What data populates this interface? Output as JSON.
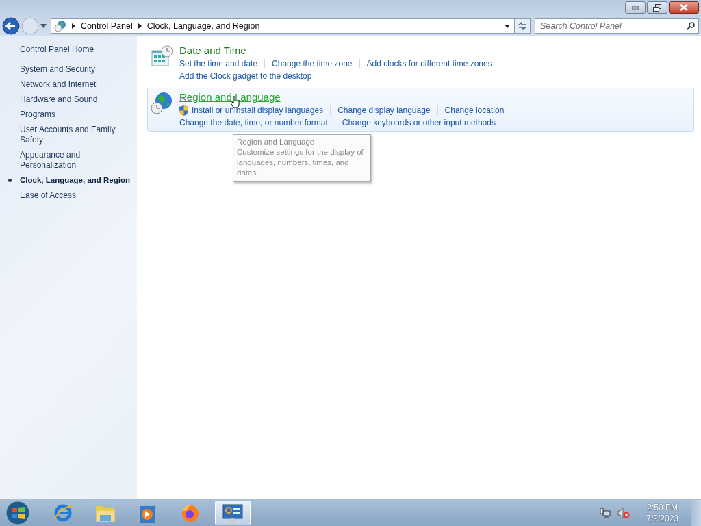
{
  "window": {
    "controls": [
      {
        "kind": "minimize"
      },
      {
        "kind": "restore"
      },
      {
        "kind": "close"
      }
    ]
  },
  "address": {
    "crumbs": [
      "Control Panel",
      "Clock, Language, and Region"
    ]
  },
  "search": {
    "placeholder": "Search Control Panel"
  },
  "sidebar": {
    "home": "Control Panel Home",
    "items": [
      {
        "label": "System and Security",
        "selected": false
      },
      {
        "label": "Network and Internet",
        "selected": false
      },
      {
        "label": "Hardware and Sound",
        "selected": false
      },
      {
        "label": "Programs",
        "selected": false
      },
      {
        "label": "User Accounts and Family Safety",
        "selected": false
      },
      {
        "label": "Appearance and Personalization",
        "selected": false
      },
      {
        "label": "Clock, Language, and Region",
        "selected": true
      },
      {
        "label": "Ease of Access",
        "selected": false
      }
    ]
  },
  "categories": [
    {
      "kind": "clock",
      "title": "Date and Time",
      "hovered": false,
      "rows": [
        [
          {
            "text": "Set the time and date",
            "shield": false
          },
          {
            "text": "Change the time zone",
            "shield": false
          },
          {
            "text": "Add clocks for different time zones",
            "shield": false
          }
        ],
        [
          {
            "text": "Add the Clock gadget to the desktop",
            "shield": false
          }
        ]
      ]
    },
    {
      "kind": "globe",
      "title": "Region and Language",
      "hovered": true,
      "rows": [
        [
          {
            "text": "Install or uninstall display languages",
            "shield": true
          },
          {
            "text": "Change display language",
            "shield": false
          },
          {
            "text": "Change location",
            "shield": false
          }
        ],
        [
          {
            "text": "Change the date, time, or number format",
            "shield": false
          },
          {
            "text": "Change keyboards or other input methods",
            "shield": false
          }
        ]
      ]
    }
  ],
  "tooltip": {
    "title": "Region and Language",
    "text": "Customize settings for the display of languages, numbers, times, and dates."
  },
  "taskbar": {
    "items": [
      {
        "kind": "ie",
        "selected": false
      },
      {
        "kind": "folder",
        "selected": false
      },
      {
        "kind": "media",
        "selected": false
      },
      {
        "kind": "firefox",
        "selected": false
      },
      {
        "kind": "control",
        "selected": true
      }
    ],
    "time": "2:50 PM",
    "date": "7/9/2023"
  }
}
